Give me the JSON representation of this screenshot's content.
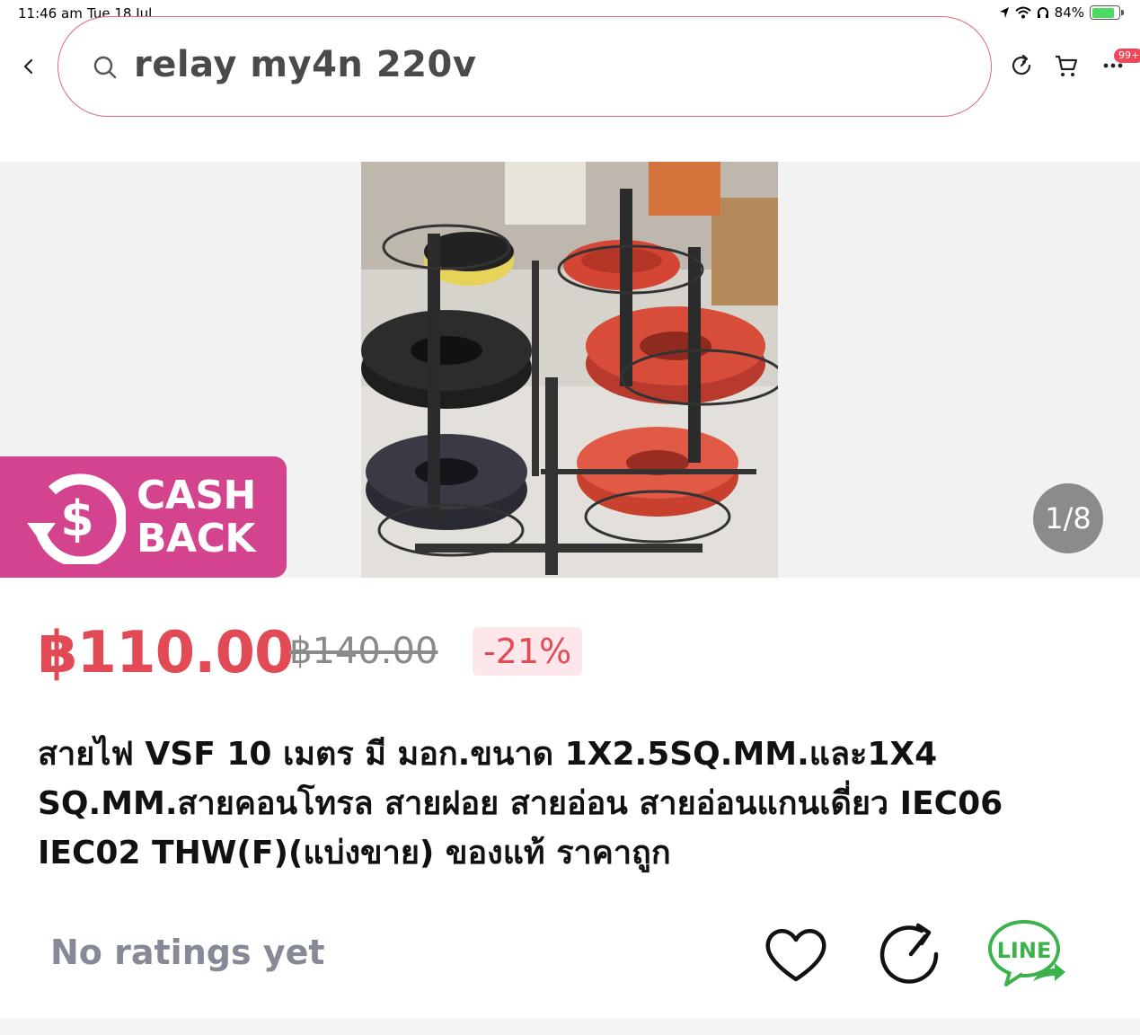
{
  "status_bar": {
    "time": "11:46 am",
    "date": "Tue 18 Jul",
    "battery": "84%",
    "battery_level": 0.84
  },
  "header": {
    "search_query": "relay my4n 220v",
    "cart_badge": "99+",
    "icons": [
      "back-icon",
      "search-icon",
      "refresh-icon",
      "cart-icon",
      "more-icon"
    ]
  },
  "gallery": {
    "cashback_line1": "CASH",
    "cashback_line2": "BACK",
    "counter": "1/8",
    "current_index": 1,
    "total_images": 8
  },
  "price": {
    "current": "฿110.00",
    "original": "฿140.00",
    "discount": "-21%"
  },
  "product": {
    "title": "สายไฟ VSF 10 เมตร มี มอก.ขนาด 1X2.5SQ.MM.และ1X4 SQ.MM.สายคอนโทรล สายฝอย สายอ่อน สายอ่อนแกนเดี่ยว IEC06 IEC02 THW(F)(แบ่งขาย) ของแท้  ราคาถูก",
    "ratings": "No ratings yet"
  },
  "actions": {
    "line_label": "LINE"
  },
  "colors": {
    "accent": "#e24b56",
    "cashback": "#d3438e",
    "line_green": "#3bb34a",
    "search_border": "#e06a74"
  }
}
